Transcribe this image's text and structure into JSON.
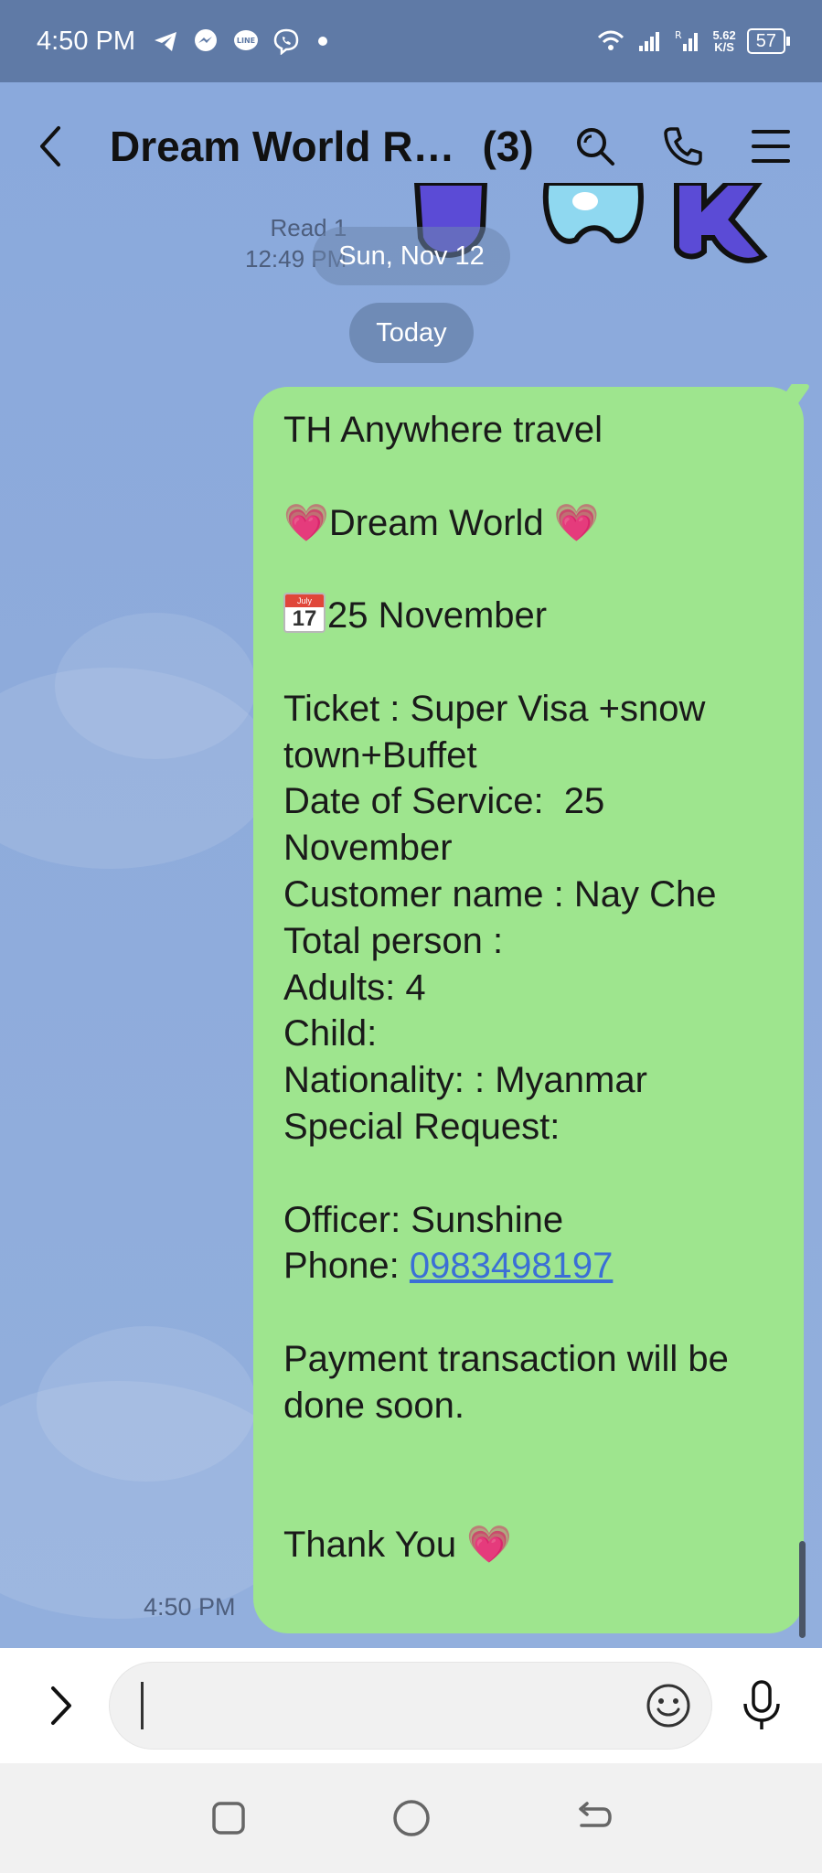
{
  "status_bar": {
    "time": "4:50 PM",
    "icons": [
      "telegram-icon",
      "messenger-icon",
      "line-icon",
      "viber-icon",
      "dot"
    ],
    "net_speed_value": "5.62",
    "net_speed_unit": "K/S",
    "battery": "57"
  },
  "header": {
    "title": "Dream World R…",
    "member_count": "(3)"
  },
  "chat": {
    "read_label": "Read 1",
    "read_time": "12:49 PM",
    "date_separator": "Sun, Nov 12",
    "today_separator": "Today",
    "message": {
      "company": "TH Anywhere travel",
      "park": "Dream World",
      "date": "25 November",
      "ticket_line1": "Ticket : Super Visa +snow",
      "ticket_line2": "town+Buffet",
      "service_line1": "Date of Service:  25",
      "service_line2": "November",
      "customer": "Customer name : Nay Che",
      "total_person": "Total person :",
      "adults": "Adults: 4",
      "child": "Child:",
      "nationality": "Nationality: : Myanmar",
      "special_request": "Special Request:",
      "officer": "Officer: Sunshine",
      "phone_label": "Phone: ",
      "phone_number": "0983498197",
      "payment_line1": "Payment transaction will be",
      "payment_line2": "done soon.",
      "thanks": "Thank You",
      "calendar_month": "July",
      "calendar_day": "17"
    },
    "message_time": "4:50 PM"
  },
  "input": {
    "placeholder": ""
  },
  "colors": {
    "bubble": "#9ee58e",
    "background": "#8aa9dc",
    "status_bar": "#5f7aa6",
    "link": "#3b6fd6",
    "heart": "#f3a4d2"
  }
}
